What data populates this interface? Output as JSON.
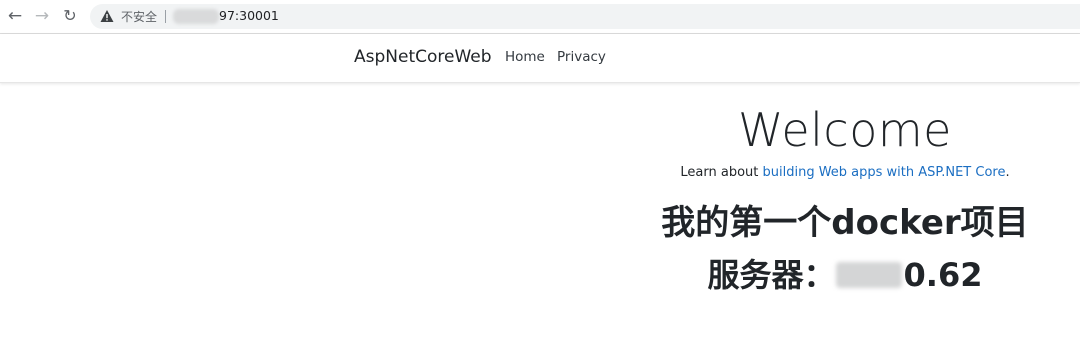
{
  "browser": {
    "back_icon": "←",
    "forward_icon": "→",
    "reload_icon": "↻",
    "security_label": "不安全",
    "url_visible": "97:30001"
  },
  "navbar": {
    "brand": "AspNetCoreWeb",
    "links": [
      {
        "label": "Home"
      },
      {
        "label": "Privacy"
      }
    ]
  },
  "main": {
    "title": "Welcome",
    "learn_prefix": "Learn about ",
    "learn_link": "building Web apps with ASP.NET Core",
    "learn_suffix": ".",
    "heading": "我的第一个docker项目",
    "server_label": "服务器：",
    "server_ip_visible": "0.62"
  }
}
